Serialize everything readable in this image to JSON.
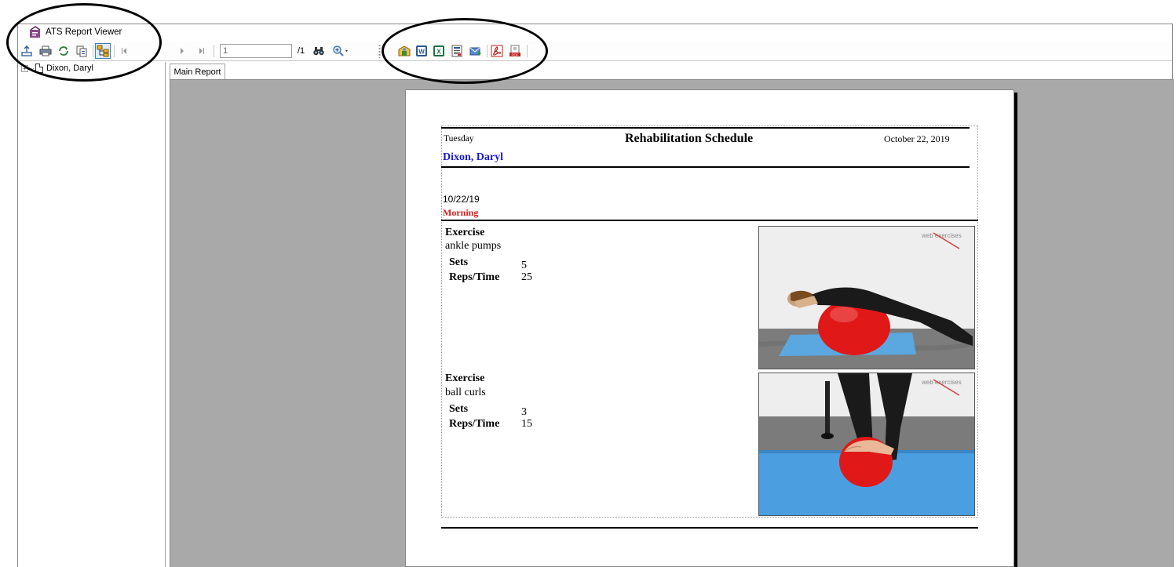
{
  "window": {
    "title": "ATS Report Viewer"
  },
  "toolbar": {
    "page_number": "1",
    "page_total": "/1",
    "buttons": [
      {
        "name": "export-icon"
      },
      {
        "name": "print-icon"
      },
      {
        "name": "refresh-icon"
      },
      {
        "name": "copy-icon"
      },
      {
        "name": "group-tree-icon"
      },
      {
        "name": "first-page-icon"
      },
      {
        "name": "next-page-icon"
      },
      {
        "name": "last-page-icon"
      },
      {
        "name": "binoculars-icon"
      },
      {
        "name": "zoom-icon"
      },
      {
        "name": "open-icon"
      },
      {
        "name": "word-icon"
      },
      {
        "name": "excel-icon"
      },
      {
        "name": "rtf-icon"
      },
      {
        "name": "email-icon"
      },
      {
        "name": "pdf-icon"
      },
      {
        "name": "pdf-save-icon"
      }
    ]
  },
  "tree": {
    "items": [
      {
        "label": "Dixon, Daryl"
      }
    ]
  },
  "tabs": [
    {
      "label": "Main Report"
    }
  ],
  "report": {
    "day": "Tuesday",
    "title": "Rehabilitation Schedule",
    "date": "October 22, 2019",
    "patient": "Dixon, Daryl",
    "session_date": "10/22/19",
    "session_time": "Morning",
    "exercises": [
      {
        "heading": "Exercise",
        "name": "ankle pumps",
        "sets_label": "Sets",
        "sets": "5",
        "reps_label": "Reps/Time",
        "reps": "25",
        "watermark": "web exercises"
      },
      {
        "heading": "Exercise",
        "name": "ball curls",
        "sets_label": "Sets",
        "sets": "3",
        "reps_label": "Reps/Time",
        "reps": "15",
        "watermark": "web exercises"
      }
    ]
  },
  "colors": {
    "patient": "#1a1ad0",
    "session": "#d42020",
    "ball": "#e01818",
    "mat": "#5ba7e0",
    "viewer_bg": "#a9a9a9"
  }
}
